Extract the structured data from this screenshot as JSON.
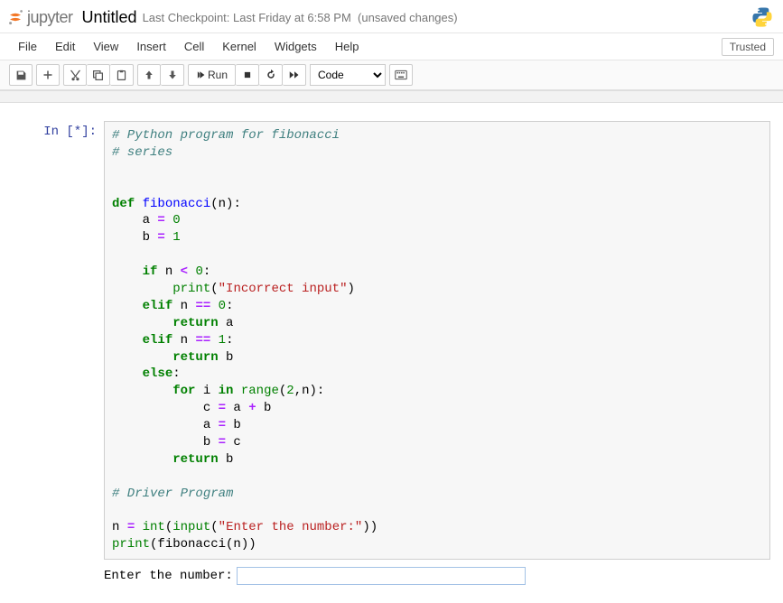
{
  "header": {
    "logo_text": "jupyter",
    "title": "Untitled",
    "checkpoint": "Last Checkpoint: Last Friday at 6:58 PM",
    "autosave": "(unsaved changes)"
  },
  "menus": {
    "file": "File",
    "edit": "Edit",
    "view": "View",
    "insert": "Insert",
    "cell": "Cell",
    "kernel": "Kernel",
    "widgets": "Widgets",
    "help": "Help",
    "trusted": "Trusted"
  },
  "toolbar": {
    "run": "Run",
    "celltype": "Code"
  },
  "cell": {
    "prompt": "In [*]:",
    "code_tokens": [
      {
        "t": "# Python program for fibonacci",
        "c": "c-comment"
      },
      {
        "t": "\n"
      },
      {
        "t": "# series",
        "c": "c-comment"
      },
      {
        "t": "\n\n\n"
      },
      {
        "t": "def",
        "c": "c-kw"
      },
      {
        "t": " "
      },
      {
        "t": "fibonacci",
        "c": "c-def"
      },
      {
        "t": "(n):"
      },
      {
        "t": "\n"
      },
      {
        "t": "    a "
      },
      {
        "t": "=",
        "c": "c-op"
      },
      {
        "t": " "
      },
      {
        "t": "0",
        "c": "c-num"
      },
      {
        "t": "\n"
      },
      {
        "t": "    b "
      },
      {
        "t": "=",
        "c": "c-op"
      },
      {
        "t": " "
      },
      {
        "t": "1",
        "c": "c-num"
      },
      {
        "t": "\n"
      },
      {
        "t": "\n"
      },
      {
        "t": "    "
      },
      {
        "t": "if",
        "c": "c-kw"
      },
      {
        "t": " n "
      },
      {
        "t": "<",
        "c": "c-op"
      },
      {
        "t": " "
      },
      {
        "t": "0",
        "c": "c-num"
      },
      {
        "t": ":"
      },
      {
        "t": "\n"
      },
      {
        "t": "        "
      },
      {
        "t": "print",
        "c": "c-builtin"
      },
      {
        "t": "("
      },
      {
        "t": "\"Incorrect input\"",
        "c": "c-str"
      },
      {
        "t": ")"
      },
      {
        "t": "\n"
      },
      {
        "t": "    "
      },
      {
        "t": "elif",
        "c": "c-kw"
      },
      {
        "t": " n "
      },
      {
        "t": "==",
        "c": "c-op"
      },
      {
        "t": " "
      },
      {
        "t": "0",
        "c": "c-num"
      },
      {
        "t": ":"
      },
      {
        "t": "\n"
      },
      {
        "t": "        "
      },
      {
        "t": "return",
        "c": "c-kw"
      },
      {
        "t": " a"
      },
      {
        "t": "\n"
      },
      {
        "t": "    "
      },
      {
        "t": "elif",
        "c": "c-kw"
      },
      {
        "t": " n "
      },
      {
        "t": "==",
        "c": "c-op"
      },
      {
        "t": " "
      },
      {
        "t": "1",
        "c": "c-num"
      },
      {
        "t": ":"
      },
      {
        "t": "\n"
      },
      {
        "t": "        "
      },
      {
        "t": "return",
        "c": "c-kw"
      },
      {
        "t": " b"
      },
      {
        "t": "\n"
      },
      {
        "t": "    "
      },
      {
        "t": "else",
        "c": "c-kw"
      },
      {
        "t": ":"
      },
      {
        "t": "\n"
      },
      {
        "t": "        "
      },
      {
        "t": "for",
        "c": "c-kw"
      },
      {
        "t": " i "
      },
      {
        "t": "in",
        "c": "c-kw"
      },
      {
        "t": " "
      },
      {
        "t": "range",
        "c": "c-builtin"
      },
      {
        "t": "("
      },
      {
        "t": "2",
        "c": "c-num"
      },
      {
        "t": ",n):"
      },
      {
        "t": "\n"
      },
      {
        "t": "            c "
      },
      {
        "t": "=",
        "c": "c-op"
      },
      {
        "t": " a "
      },
      {
        "t": "+",
        "c": "c-op"
      },
      {
        "t": " b"
      },
      {
        "t": "\n"
      },
      {
        "t": "            a "
      },
      {
        "t": "=",
        "c": "c-op"
      },
      {
        "t": " b"
      },
      {
        "t": "\n"
      },
      {
        "t": "            b "
      },
      {
        "t": "=",
        "c": "c-op"
      },
      {
        "t": " c"
      },
      {
        "t": "\n"
      },
      {
        "t": "        "
      },
      {
        "t": "return",
        "c": "c-kw"
      },
      {
        "t": " b"
      },
      {
        "t": "\n"
      },
      {
        "t": "\n"
      },
      {
        "t": "# Driver Program",
        "c": "c-comment"
      },
      {
        "t": "\n"
      },
      {
        "t": "\n"
      },
      {
        "t": "n "
      },
      {
        "t": "=",
        "c": "c-op"
      },
      {
        "t": " "
      },
      {
        "t": "int",
        "c": "c-builtin"
      },
      {
        "t": "("
      },
      {
        "t": "input",
        "c": "c-builtin"
      },
      {
        "t": "("
      },
      {
        "t": "\"Enter the number:\"",
        "c": "c-str"
      },
      {
        "t": "))"
      },
      {
        "t": "\n"
      },
      {
        "t": "print",
        "c": "c-builtin"
      },
      {
        "t": "(fibonacci(n))"
      }
    ]
  },
  "output": {
    "prompt_text": "Enter the number:",
    "input_value": ""
  }
}
